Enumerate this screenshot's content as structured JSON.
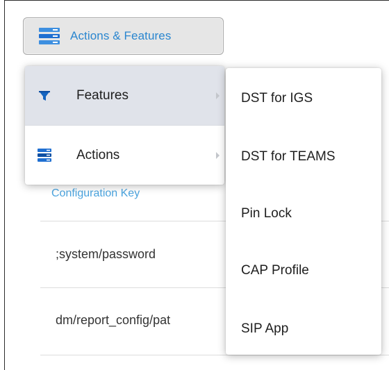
{
  "toolbar": {
    "actions_features_label": "Actions & Features"
  },
  "menu": {
    "items": [
      {
        "label": "Features",
        "icon": "filter-icon",
        "highlighted": true
      },
      {
        "label": "Actions",
        "icon": "server-stack-icon",
        "highlighted": false
      }
    ]
  },
  "submenu": {
    "items": [
      {
        "label": "DST for IGS"
      },
      {
        "label": "DST for TEAMS"
      },
      {
        "label": "Pin Lock"
      },
      {
        "label": "CAP Profile"
      },
      {
        "label": "SIP App"
      }
    ]
  },
  "table": {
    "header": "Configuration Key",
    "rows": [
      {
        "key": ";system/password"
      },
      {
        "key": "dm/report_config/pat"
      }
    ]
  },
  "colors": {
    "accent": "#2a86cf",
    "header_link": "#4aa3de",
    "highlight_bg": "#e0e3ea",
    "icon_blue": "#1565c0"
  }
}
